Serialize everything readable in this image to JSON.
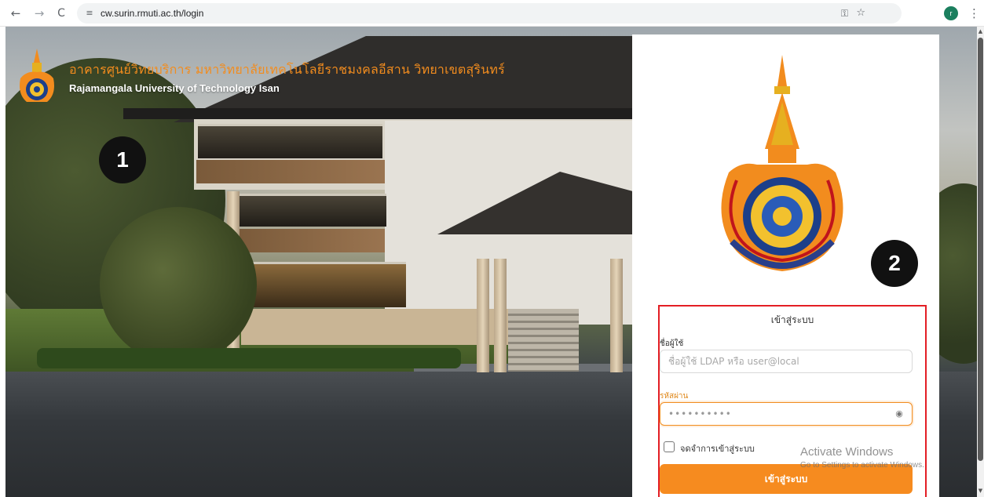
{
  "browser": {
    "url": "cw.surin.rmuti.ac.th/login",
    "back_icon": "←",
    "forward_icon": "→",
    "reload_icon": "C",
    "site_info_icon": "≡",
    "password_key_icon": "⚿",
    "star_icon": "☆",
    "profile_initial": "r",
    "menu_icon": "⋮"
  },
  "header": {
    "title": "อาคารศูนย์วิทยบริการ มหาวิทยาลัยเทคโนโลยีราชมงคลอีสาน วิทยาเขตสุรินทร์",
    "subtitle": "Rajamangala University of Technology Isan"
  },
  "badges": {
    "step1": "1",
    "step2": "2"
  },
  "login": {
    "title": "เข้าสู่ระบบ",
    "username_label": "ชื่อผู้ใช้",
    "username_placeholder": "ชื่อผู้ใช้ LDAP หรือ user@local",
    "password_label": "รหัสผ่าน",
    "password_value": "••••••••••",
    "eye_icon": "◉",
    "remember_label": "จดจำการเข้าสู่ระบบ",
    "remember_checked": false,
    "submit_label": "เข้าสู่ระบบ"
  },
  "watermark": {
    "line1": "Activate Windows",
    "line2": "Go to Settings to activate Windows."
  },
  "colors": {
    "accent": "#f68b1f",
    "title_orange": "#f28c1e",
    "highlight_border": "#e31e24"
  }
}
